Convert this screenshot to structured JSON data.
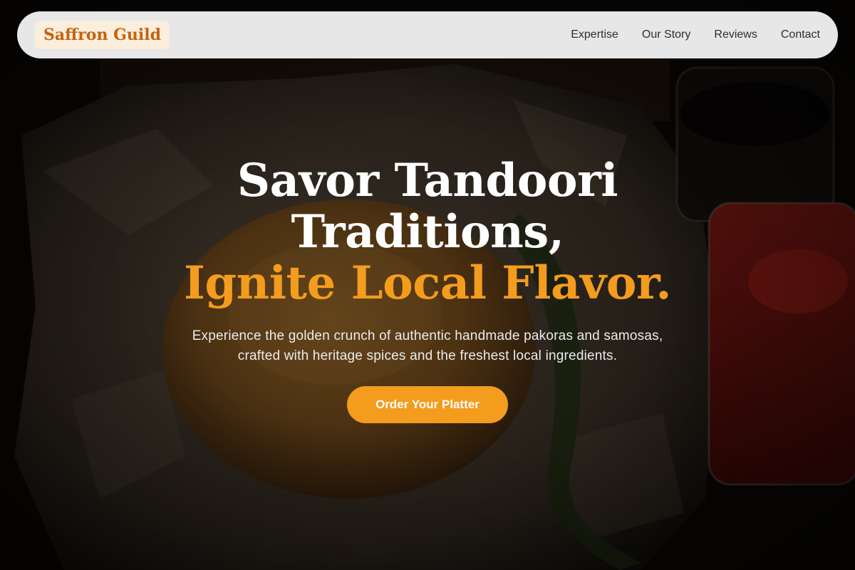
{
  "colors": {
    "accent": "#f39c1e",
    "brand_text": "#c5630f",
    "cta_background": "#f39c1e"
  },
  "nav": {
    "brand": "Saffron Guild",
    "links": [
      "Expertise",
      "Our Story",
      "Reviews",
      "Contact"
    ]
  },
  "hero": {
    "title_line_1": "Savor Tandoori",
    "title_line_2": "Traditions,",
    "title_accent": "Ignite Local Flavor.",
    "subtitle": "Experience the golden crunch of authentic handmade pakoras and samosas, crafted with heritage spices and the freshest local ingredients.",
    "cta_label": "Order Your Platter",
    "background_image": "samosa-with-chutney-photo"
  }
}
